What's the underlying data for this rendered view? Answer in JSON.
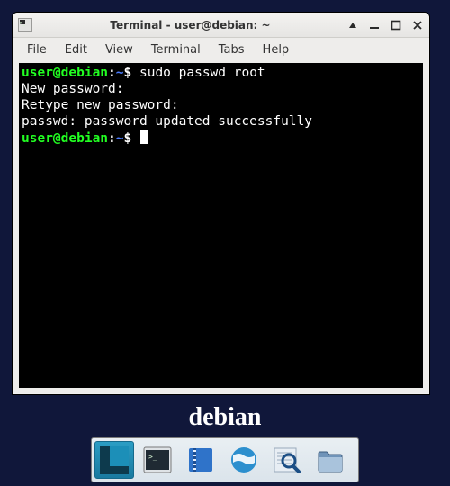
{
  "window": {
    "title": "Terminal - user@debian: ~"
  },
  "menu": {
    "file": "File",
    "edit": "Edit",
    "view": "View",
    "terminal": "Terminal",
    "tabs": "Tabs",
    "help": "Help"
  },
  "terminal": {
    "prompt": {
      "user": "user",
      "at": "@",
      "host": "debian",
      "colon": ":",
      "path": "~",
      "symbol": "$ "
    },
    "lines": {
      "cmd1": "sudo passwd root",
      "out1": "New password:",
      "out2": "Retype new password:",
      "out3": "passwd: password updated successfully"
    }
  },
  "branding": {
    "os_name": "debian"
  }
}
